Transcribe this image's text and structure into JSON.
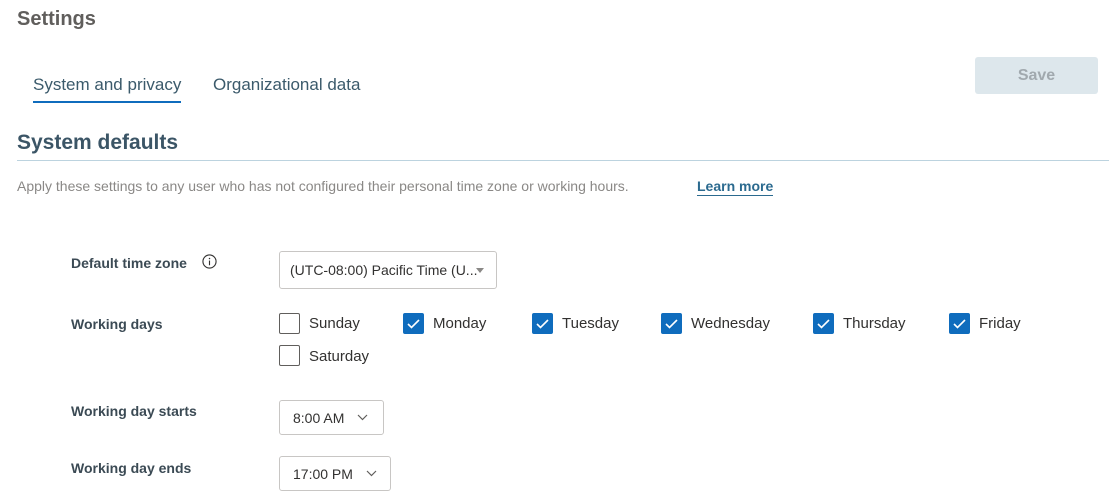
{
  "page": {
    "title": "Settings"
  },
  "tabs": [
    {
      "label": "System and privacy",
      "active": true
    },
    {
      "label": "Organizational data",
      "active": false
    }
  ],
  "toolbar": {
    "save_label": "Save",
    "save_enabled": false
  },
  "section": {
    "title": "System defaults",
    "description": "Apply these settings to any user who has not configured their personal time zone or working hours.",
    "learn_more": "Learn more"
  },
  "form": {
    "time_zone": {
      "label": "Default time zone",
      "value": "(UTC-08:00) Pacific Time (U..."
    },
    "working_days": {
      "label": "Working days",
      "days": [
        {
          "name": "Sunday",
          "checked": false
        },
        {
          "name": "Monday",
          "checked": true
        },
        {
          "name": "Tuesday",
          "checked": true
        },
        {
          "name": "Wednesday",
          "checked": true
        },
        {
          "name": "Thursday",
          "checked": true
        },
        {
          "name": "Friday",
          "checked": true
        },
        {
          "name": "Saturday",
          "checked": false
        }
      ]
    },
    "start": {
      "label": "Working day starts",
      "value": "8:00 AM"
    },
    "end": {
      "label": "Working day ends",
      "value": "17:00 PM"
    }
  },
  "colors": {
    "accent": "#0f6cbd",
    "save_disabled_bg": "#dde7ec"
  },
  "icons": {
    "info": "info-icon",
    "check": "checkmark-icon",
    "dropdown": "chevron-down-icon"
  }
}
